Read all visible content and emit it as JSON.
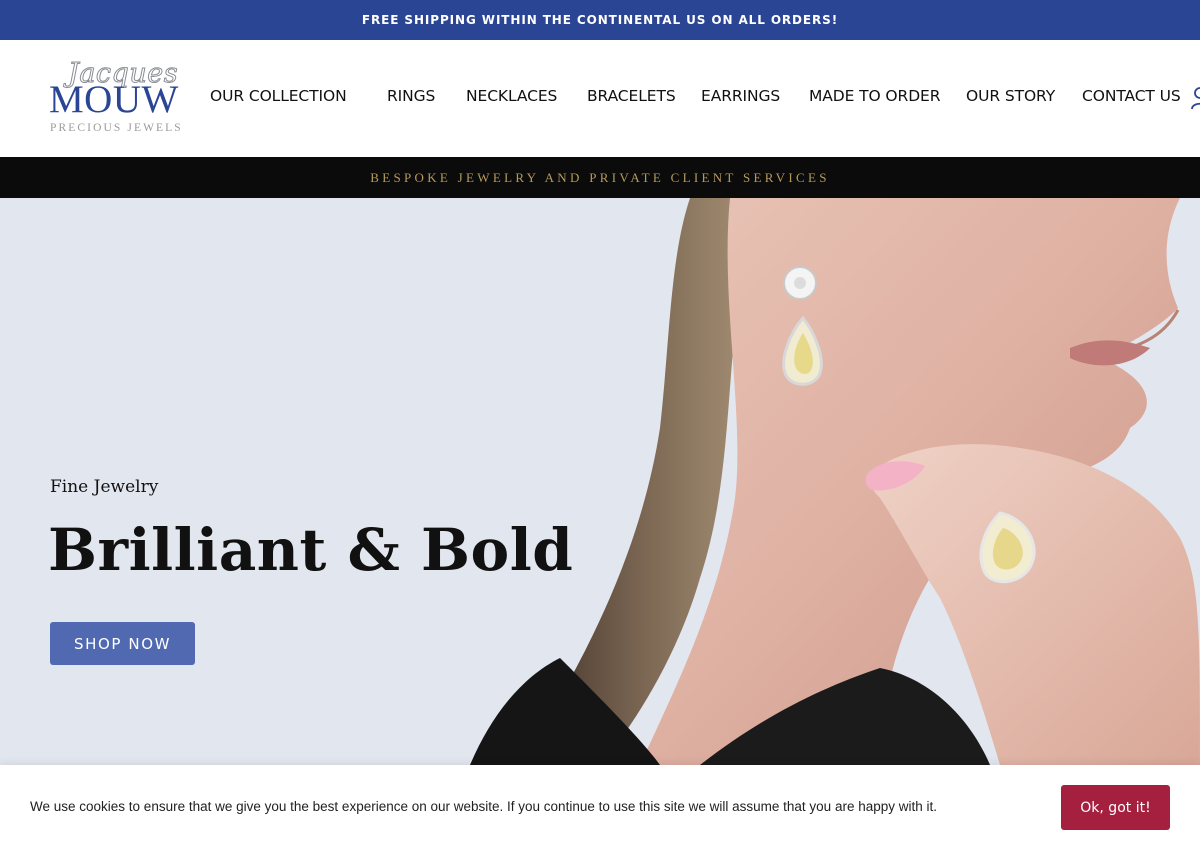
{
  "announcement": {
    "text": "FREE SHIPPING WITHIN THE CONTINENTAL US ON ALL ORDERS!"
  },
  "brand": {
    "logo_script": "Jacques",
    "logo_main": "MOUW",
    "logo_sub": "PRECIOUS JEWELS",
    "primary_color": "#2a4594"
  },
  "nav": {
    "items": [
      {
        "label": "OUR COLLECTION"
      },
      {
        "label": "RINGS"
      },
      {
        "label": "NECKLACES"
      },
      {
        "label": "BRACELETS"
      },
      {
        "label": "EARRINGS"
      },
      {
        "label": "MADE TO ORDER"
      },
      {
        "label": "OUR STORY"
      },
      {
        "label": "CONTACT US"
      }
    ],
    "account_icon": "user-icon"
  },
  "strip": {
    "text": "BESPOKE JEWELRY AND PRIVATE CLIENT SERVICES",
    "color": "#b79a5a"
  },
  "hero": {
    "kicker": "Fine Jewelry",
    "title": "Brilliant & Bold",
    "button_label": "SHOP NOW",
    "button_color": "#5069b0",
    "background_color": "#e2e6ef"
  },
  "cookie": {
    "message": "We use cookies to ensure that we give you the best experience on our website. If you continue to use this site we will assume that you are happy with it.",
    "button_label": "Ok, got it!",
    "button_color": "#a5203f"
  }
}
